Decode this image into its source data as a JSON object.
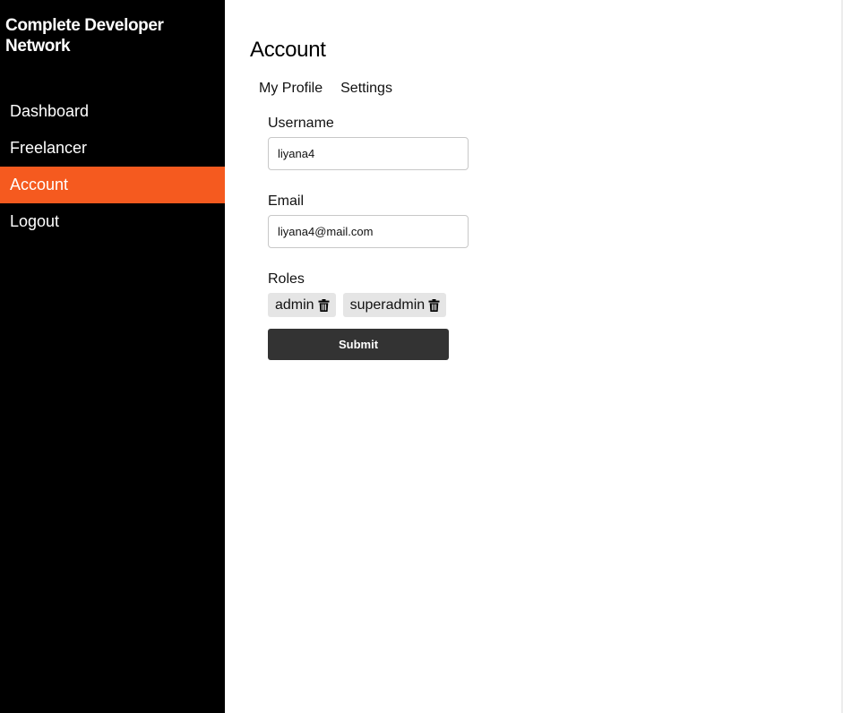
{
  "sidebar": {
    "brand": "Complete Developer Network",
    "items": [
      {
        "label": "Dashboard"
      },
      {
        "label": "Freelancer"
      },
      {
        "label": "Account"
      },
      {
        "label": "Logout"
      }
    ],
    "active_color": "#f55a1f"
  },
  "main": {
    "title": "Account",
    "tabs": [
      {
        "label": "My Profile"
      },
      {
        "label": "Settings"
      }
    ],
    "form": {
      "username_label": "Username",
      "username_value": "liyana4",
      "email_label": "Email",
      "email_value": "liyana4@mail.com",
      "roles_label": "Roles",
      "roles": [
        {
          "name": "admin",
          "icon": "trash-icon"
        },
        {
          "name": "superadmin",
          "icon": "trash-icon"
        }
      ],
      "submit_label": "Submit"
    }
  }
}
